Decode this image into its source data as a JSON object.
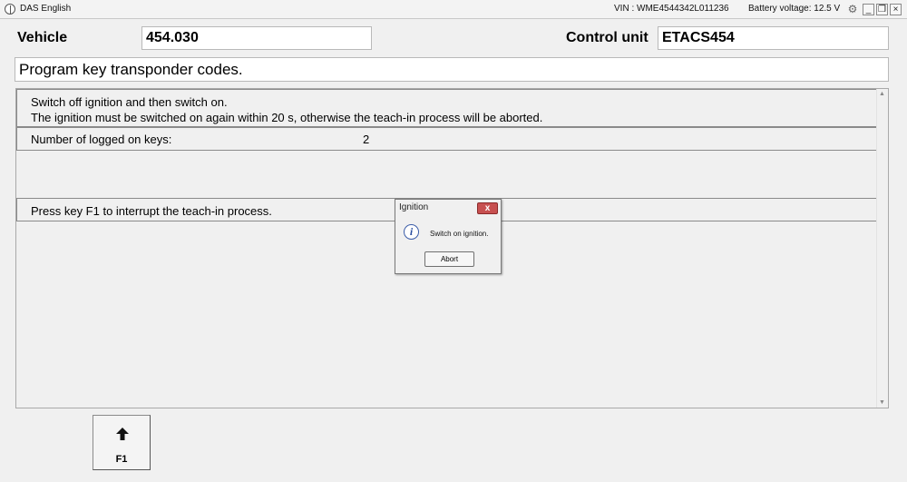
{
  "titlebar": {
    "app_title": "DAS English",
    "vin": "VIN : WME4544342L011236",
    "battery": "Battery voltage: 12.5 V",
    "minimize": "_",
    "restore": "❐",
    "close": "×"
  },
  "header": {
    "vehicle_label": "Vehicle",
    "vehicle_value": "454.030",
    "control_unit_label": "Control unit",
    "control_unit_value": "ETACS454"
  },
  "description": "Program key transponder codes.",
  "messages": {
    "line1": "Switch off ignition and then switch on.",
    "line2": "The ignition must be switched on again within 20 s, otherwise the teach-in process will be aborted.",
    "keys_label": "Number of logged on keys:",
    "keys_value": "2",
    "interrupt": "Press key F1 to interrupt the teach-in process."
  },
  "dialog": {
    "title": "Ignition",
    "message": "Switch on ignition.",
    "button": "Abort"
  },
  "function_keys": [
    {
      "label": "F1",
      "icon": "up-arrow-icon"
    }
  ]
}
